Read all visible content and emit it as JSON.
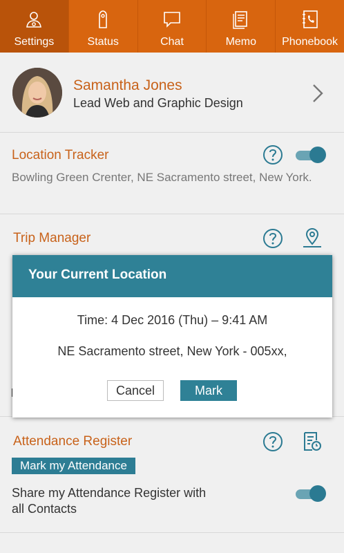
{
  "tabs": [
    {
      "label": "Settings",
      "icon": "settings-user-icon",
      "active": true
    },
    {
      "label": "Status",
      "icon": "door-hanger-icon",
      "active": false
    },
    {
      "label": "Chat",
      "icon": "chat-bubble-icon",
      "active": false
    },
    {
      "label": "Memo",
      "icon": "memo-icon",
      "active": false
    },
    {
      "label": "Phonebook",
      "icon": "phonebook-icon",
      "active": false
    }
  ],
  "profile": {
    "name": "Samantha Jones",
    "role": "Lead Web and Graphic Design"
  },
  "location_tracker": {
    "title": "Location Tracker",
    "address": "Bowling Green Crenter, NE Sacramento street, New York.",
    "enabled": true
  },
  "trip_manager": {
    "title": "Trip Manager"
  },
  "attendance": {
    "title": "Attendance Register",
    "mark_label": "Mark my Attendance",
    "share_label": "Share my Attendance Register with all Contacts",
    "share_enabled": true
  },
  "dialog": {
    "title": "Your Current Location",
    "time": "Time: 4 Dec 2016 (Thu) – 9:41 AM",
    "address": "NE Sacramento street, New York - 005xx,",
    "cancel_label": "Cancel",
    "mark_label": "Mark"
  },
  "colors": {
    "accent": "#d8650f",
    "teal": "#2f8196",
    "title_orange": "#c8621a"
  }
}
